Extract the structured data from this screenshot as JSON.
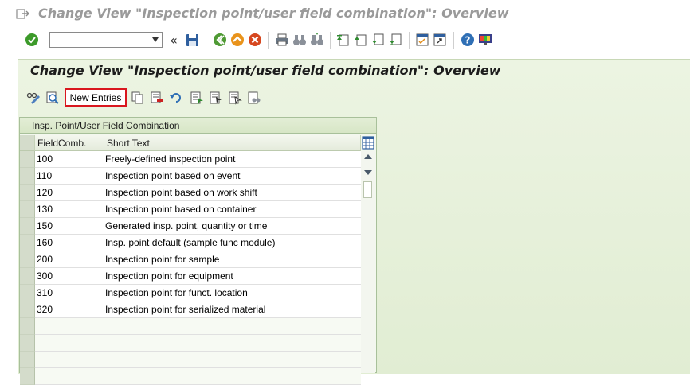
{
  "window": {
    "title": "Change View \"Inspection point/user field combination\": Overview"
  },
  "toolbar": {
    "command_field_value": "",
    "double_arrow": "«"
  },
  "page": {
    "title": "Change View \"Inspection point/user field combination\": Overview"
  },
  "app_toolbar": {
    "new_entries_label": "New Entries"
  },
  "table": {
    "caption": "Insp. Point/User Field Combination",
    "columns": [
      "FieldComb.",
      "Short Text"
    ],
    "rows": [
      [
        "100",
        "Freely-defined inspection point"
      ],
      [
        "110",
        "Inspection point based on event"
      ],
      [
        "120",
        "Inspection point based on work shift"
      ],
      [
        "130",
        "Inspection point based on container"
      ],
      [
        "150",
        "Generated insp. point, quantity or time"
      ],
      [
        "160",
        "Insp. point default (sample func module)"
      ],
      [
        "200",
        "Inspection point for sample"
      ],
      [
        "300",
        "Inspection point for equipment"
      ],
      [
        "310",
        "Inspection point for funct. location"
      ],
      [
        "320",
        "Inspection point for serialized material"
      ]
    ]
  },
  "colors": {
    "accent": "#d9171f",
    "content_bg": "#e1edd3",
    "title_gray": "#9a9a9a"
  }
}
